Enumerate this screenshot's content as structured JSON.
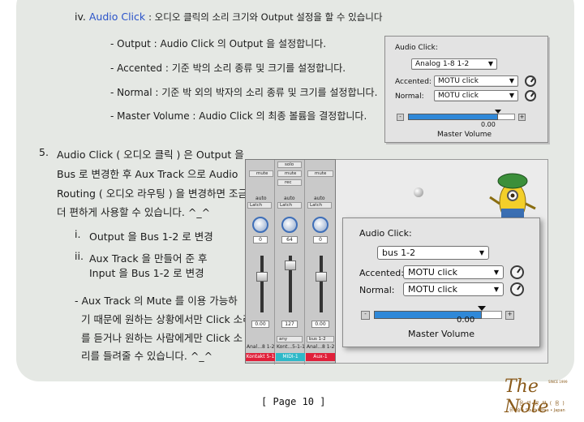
{
  "section_iv": {
    "num": "iv.",
    "term": "Audio Click",
    "rest": ": 오디오 클릭의 소리 크기와 Output 설정을 할 수 있습니다"
  },
  "options": [
    "- Output : Audio Click 의 Output 을 설정합니다.",
    "- Accented : 기준 박의 소리 종류 및 크기를 설정합니다.",
    "- Normal : 기준 박 외의 박자의 소리 종류 및 크기를 설정합니다.",
    "- Master Volume : Audio Click 의 최종 볼륨을 결정합니다."
  ],
  "panel1": {
    "title": "Audio Click:",
    "output_value": "Analog 1-8 1-2",
    "accented_label": "Accented:",
    "accented_value": "MOTU click",
    "normal_label": "Normal:",
    "normal_value": "MOTU click",
    "volume_readout": "0.00",
    "volume_level": 0.84,
    "master_label": "Master Volume",
    "minus": "-",
    "plus": "+"
  },
  "step5": {
    "num": "5.",
    "lines": [
      "Audio Click ( 오디오 클릭 ) 은 Output 을",
      "Bus 로 변경한 후 Aux Track 으로 Audio",
      "Routing ( 오디오 라우팅 ) 을 변경하면 조금",
      "더 편하게 사용할 수 있습니다. ^_^"
    ]
  },
  "sub_i": {
    "num": "i.",
    "text": "Output 을 Bus 1-2 로 변경"
  },
  "sub_ii": {
    "num": "ii.",
    "line1": "Aux Track 을 만들어 준 후",
    "line2": "Input 을 Bus 1-2 로 변경"
  },
  "note_lines": [
    "- Aux Track 의 Mute 를 이용 가능하",
    "기 때문에 원하는 상황에서만 Click 소리",
    "를 듣거나 원하는 사람에게만 Click 소",
    "리를 들려줄 수 있습니다. ^_^"
  ],
  "mixer": {
    "solo": "solo",
    "mute": "mute",
    "rec": "rec",
    "auto": "auto",
    "latch": "Latch",
    "strips": [
      {
        "pan": "0",
        "value": "0.00",
        "input": "",
        "output": "Anal...8 1-2",
        "name": "Kontakt 5-1",
        "color": "#e0203a"
      },
      {
        "pan": "64",
        "value": "127",
        "input": "any",
        "output": "Kont...5-1-1",
        "name": "MIDI-1",
        "color": "#2fb8c8"
      },
      {
        "pan": "0",
        "value": "0.00",
        "input": "bus 1-2",
        "output": "Anal...8 1-2",
        "name": "Aux-1",
        "color": "#e0203a"
      }
    ]
  },
  "panel2": {
    "title": "Audio Click:",
    "output_value": "bus 1-2",
    "accented_label": "Accented:",
    "accented_value": "MOTU click",
    "normal_label": "Normal:",
    "normal_value": "MOTU click",
    "volume_readout": "0.00",
    "volume_level": 0.84,
    "master_label": "Master Volume",
    "minus": "-",
    "plus": "+"
  },
  "page": {
    "label": "[ Page 10 ]"
  },
  "logo": {
    "title": "The Note",
    "since": "SINCE 1999",
    "sub": "음 악 공 부 ( 음 )",
    "small": "뮤직숍 • SouthKorea • Japan"
  }
}
